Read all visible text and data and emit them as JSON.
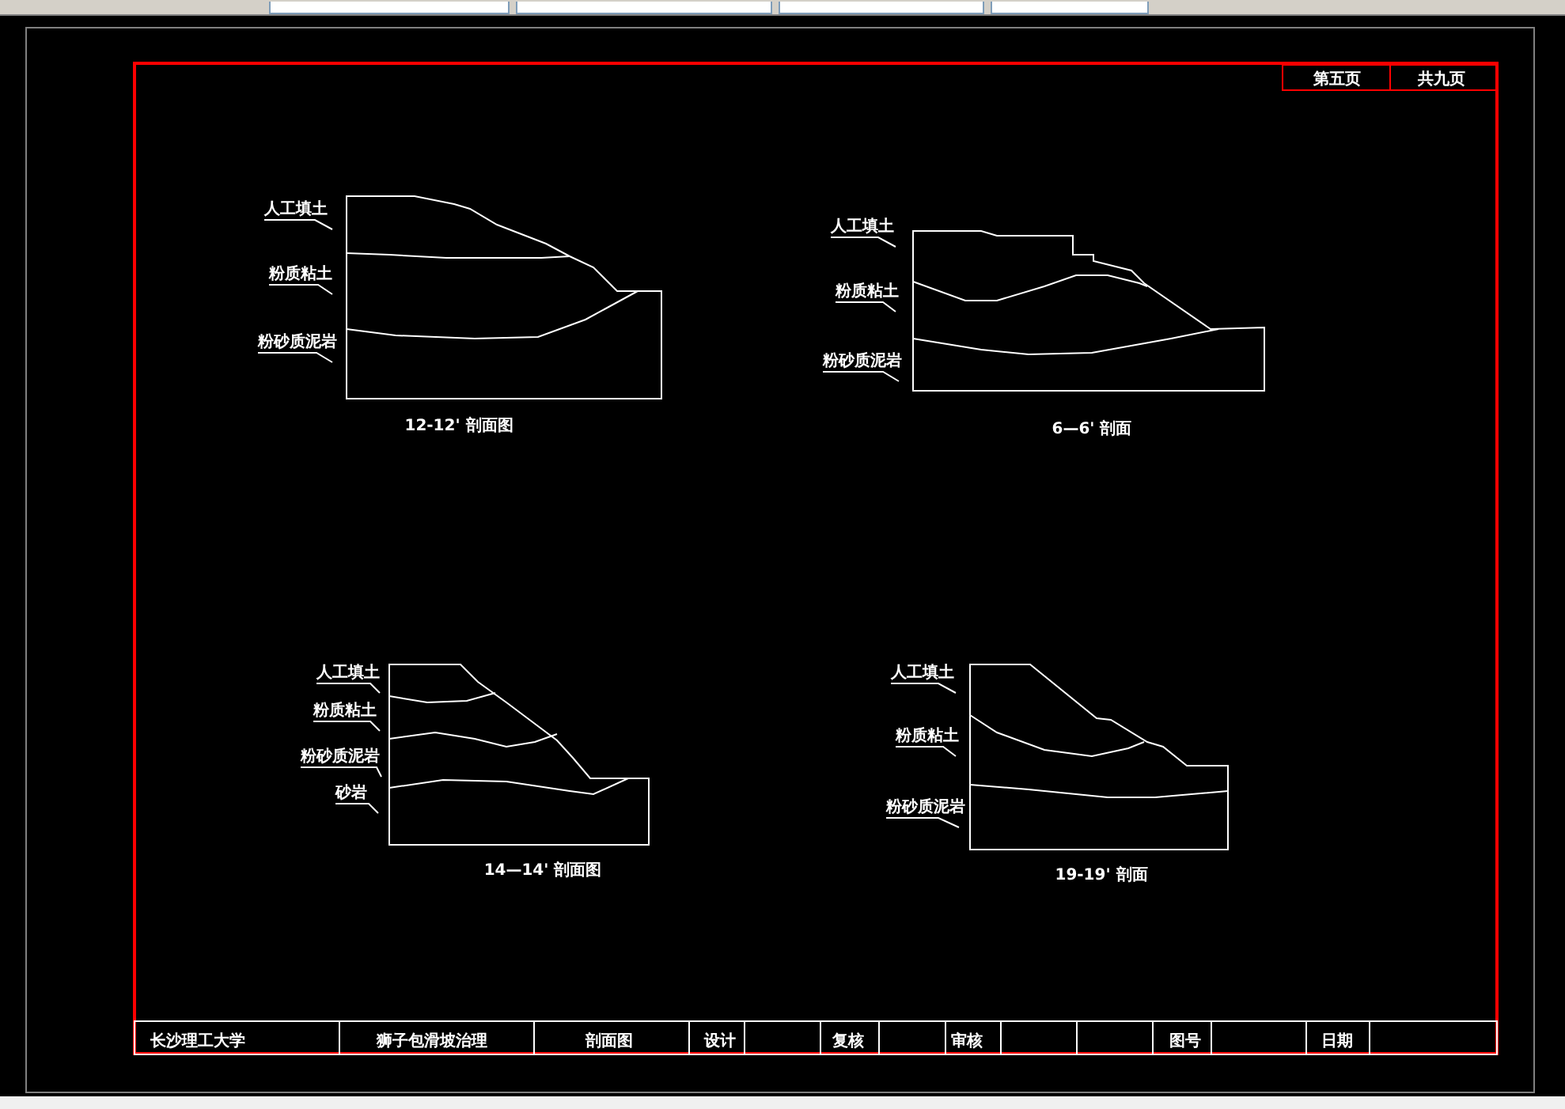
{
  "sheet": {
    "page_number": "第五页",
    "page_total": "共九页"
  },
  "sections": [
    {
      "caption": "12-12' 剖面图",
      "layers": [
        "人工填土",
        "粉质粘土",
        "粉砂质泥岩"
      ]
    },
    {
      "caption": "6—6' 剖面",
      "layers": [
        "人工填土",
        "粉质粘土",
        "粉砂质泥岩"
      ]
    },
    {
      "caption": "14—14' 剖面图",
      "layers": [
        "人工填土",
        "粉质粘土",
        "粉砂质泥岩",
        "砂岩"
      ]
    },
    {
      "caption": "19-19' 剖面",
      "layers": [
        "人工填土",
        "粉质粘土",
        "粉砂质泥岩"
      ]
    }
  ],
  "title_block": {
    "cells": [
      "长沙理工大学",
      "狮子包滑坡治理",
      "剖面图",
      "设计",
      "复核",
      "审核",
      "图号",
      "日期"
    ]
  }
}
